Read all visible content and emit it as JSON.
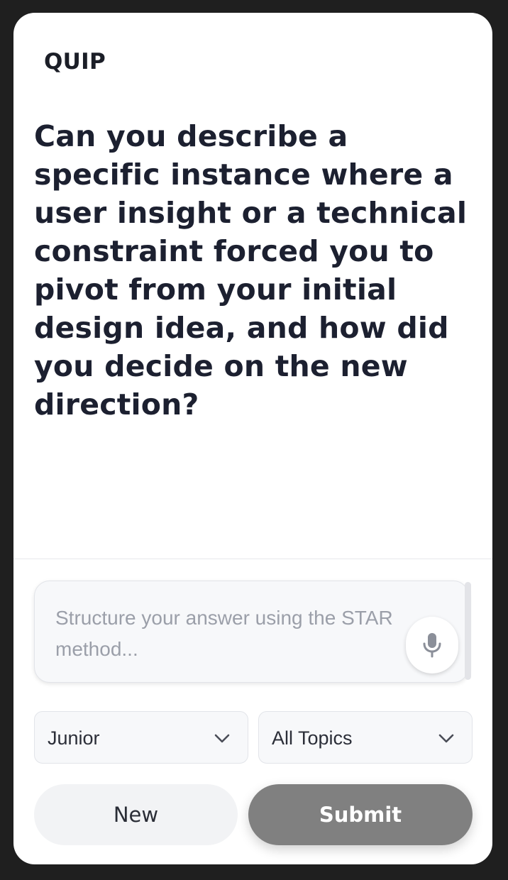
{
  "header": {
    "brand": "QUIP"
  },
  "question": {
    "text": "Can you describe a specific instance where a user insight or a technical constraint forced you to pivot from your initial design idea, and how did you decide on the new direction?"
  },
  "answer": {
    "value": "",
    "placeholder": "Structure your answer using the STAR method..."
  },
  "filters": {
    "level": {
      "selected": "Junior"
    },
    "topic": {
      "selected": "All Topics"
    }
  },
  "actions": {
    "new_label": "New",
    "submit_label": "Submit"
  },
  "icons": {
    "mic": "microphone-icon",
    "chevron": "chevron-down-icon"
  },
  "colors": {
    "background": "#1f1f1f",
    "card": "#ffffff",
    "text": "#1c2030",
    "submit": "#808080",
    "new": "#f2f3f5"
  }
}
